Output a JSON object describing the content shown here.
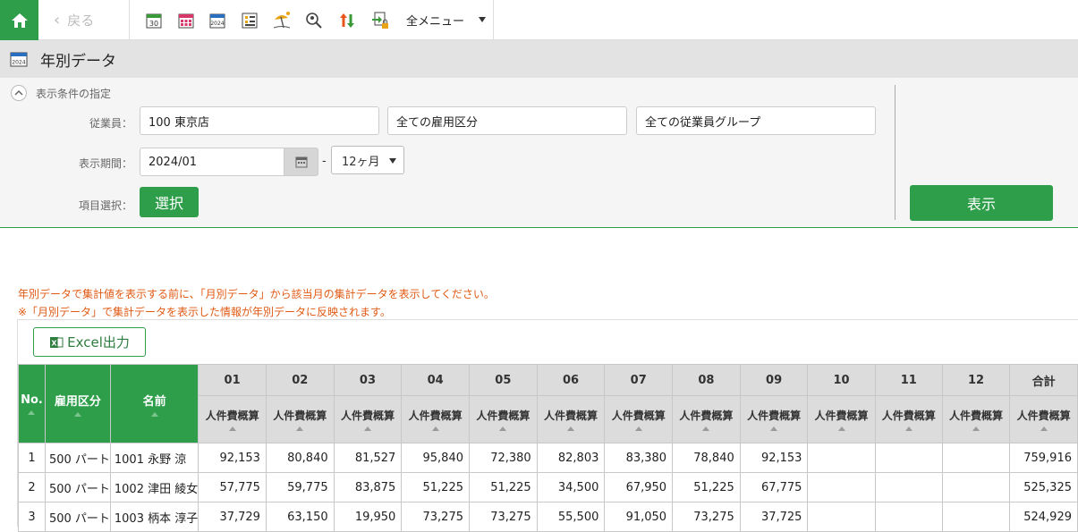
{
  "nav": {
    "back_label": "戻る",
    "all_menu_label": "全メニュー",
    "tool_icons": [
      "calendar-30-icon",
      "calendar-grid-icon",
      "calendar-2024-icon",
      "list-chart-icon",
      "beach-umbrella-icon",
      "search-user-icon",
      "sort-arrows-icon",
      "export-lock-icon"
    ]
  },
  "page": {
    "title": "年別データ",
    "title_icon_text": "2024"
  },
  "filter": {
    "section_label": "表示条件の指定",
    "employee_label": "従業員：",
    "employee_value": "100 東京店",
    "employment_type_value": "全ての雇用区分",
    "employee_group_value": "全ての従業員グループ",
    "period_label": "表示期間：",
    "period_start": "2024/01",
    "period_sep": "-",
    "period_length": "12ヶ月",
    "item_label": "項目選択：",
    "select_button": "選択",
    "show_button": "表示"
  },
  "notice": {
    "line1": "年別データで集計値を表示する前に、「月別データ」から該当月の集計データを表示してください。",
    "line2": "※「月別データ」で集計データを表示した情報が年別データに反映されます。"
  },
  "excel_button": "Excel出力",
  "colors": {
    "brand_green": "#2e9e4a",
    "notice_orange": "#e05a14",
    "header_gray": "#dcdcdc"
  },
  "table": {
    "fixed_headers": {
      "no": "No.",
      "type": "雇用区分",
      "name": "名前"
    },
    "months": [
      "01",
      "02",
      "03",
      "04",
      "05",
      "06",
      "07",
      "08",
      "09",
      "10",
      "11",
      "12",
      "合計"
    ],
    "metric": "人件費概算",
    "rows": [
      {
        "no": "1",
        "type": "500 パート",
        "name": "1001 永野 涼",
        "values": [
          "92,153",
          "80,840",
          "81,527",
          "95,840",
          "72,380",
          "82,803",
          "83,380",
          "78,840",
          "92,153",
          "",
          "",
          "",
          "759,916"
        ]
      },
      {
        "no": "2",
        "type": "500 パート",
        "name": "1002 津田 綾女",
        "values": [
          "57,775",
          "59,775",
          "83,875",
          "51,225",
          "51,225",
          "34,500",
          "67,950",
          "51,225",
          "67,775",
          "",
          "",
          "",
          "525,325"
        ]
      },
      {
        "no": "3",
        "type": "500 パート",
        "name": "1003 柄本 淳子",
        "values": [
          "37,729",
          "63,150",
          "19,950",
          "73,275",
          "73,275",
          "55,500",
          "91,050",
          "73,275",
          "37,725",
          "",
          "",
          "",
          "524,929"
        ]
      }
    ]
  }
}
